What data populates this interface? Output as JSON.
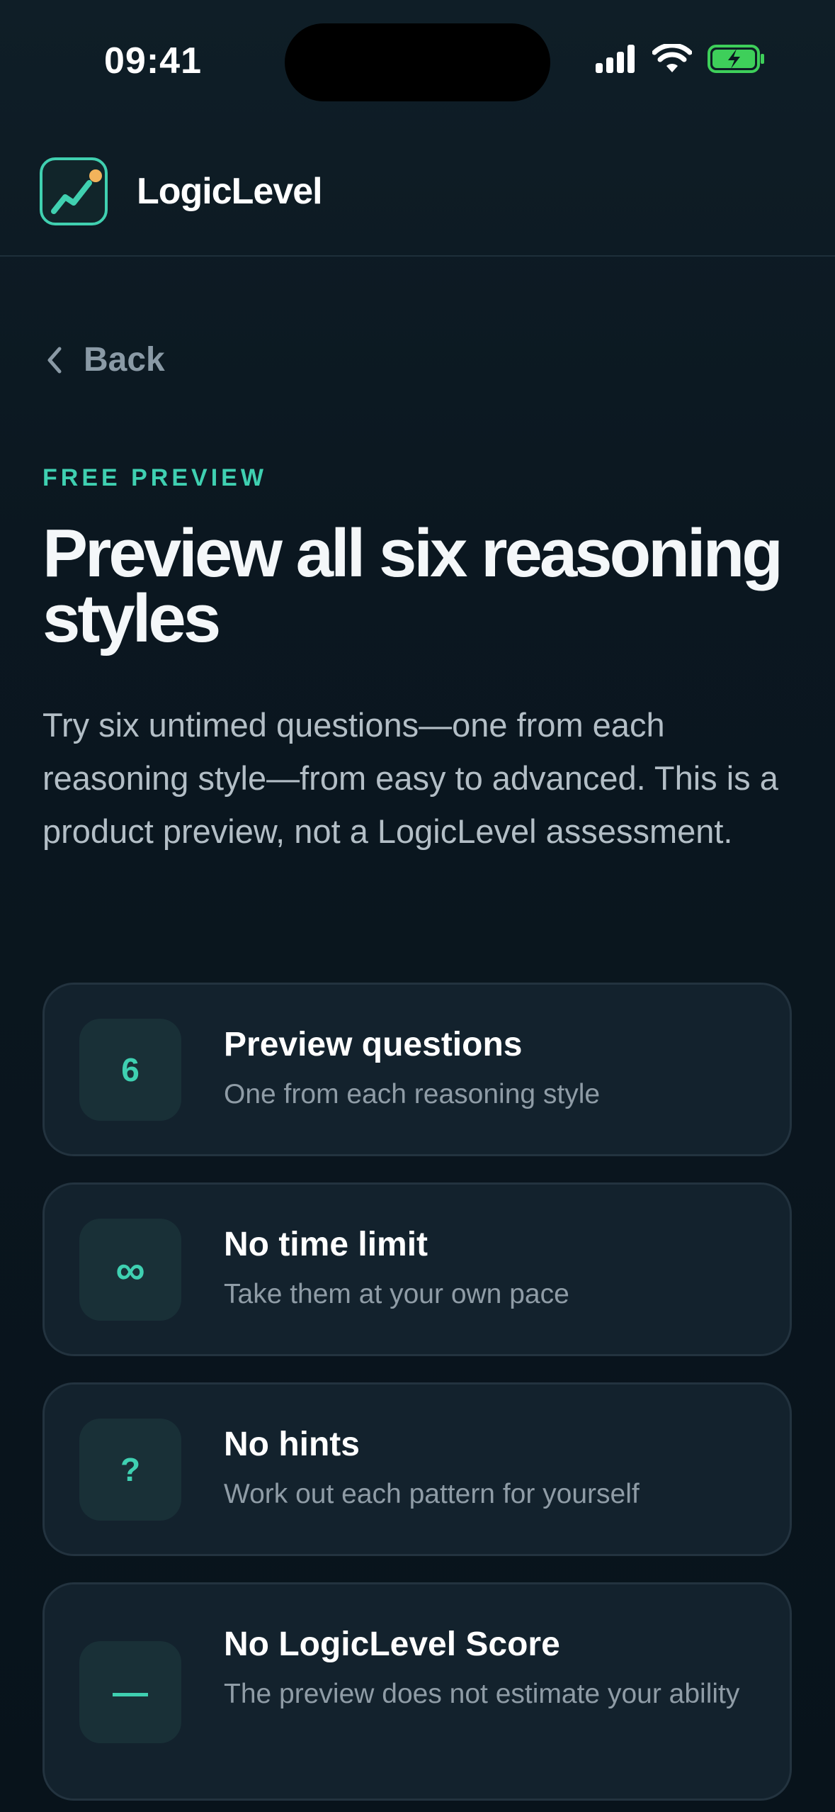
{
  "status_bar": {
    "time": "09:41"
  },
  "header": {
    "app_name": "LogicLevel"
  },
  "nav": {
    "back_label": "Back"
  },
  "hero": {
    "eyebrow": "FREE PREVIEW",
    "title": "Preview all six reasoning styles",
    "description": "Try six untimed questions—one from each reasoning style—from easy to advanced. This is a product preview, not a LogicLevel assessment."
  },
  "features": [
    {
      "badge": "6",
      "title": "Preview questions",
      "subtitle": "One from each reasoning style"
    },
    {
      "badge": "∞",
      "title": "No time limit",
      "subtitle": "Take them at your own pace"
    },
    {
      "badge": "?",
      "title": "No hints",
      "subtitle": "Work out each pattern for yourself"
    },
    {
      "badge": "—",
      "title": "No LogicLevel Score",
      "subtitle": "The preview does not estimate your ability"
    }
  ],
  "colors": {
    "accent": "#3fd0b1",
    "battery": "#3ecf5a",
    "logo_dot": "#f2b35b"
  }
}
